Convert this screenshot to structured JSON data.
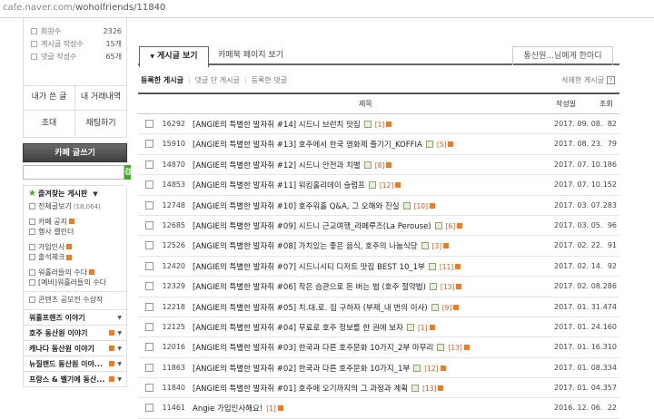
{
  "browser": {
    "url_prefix": "cafe.naver.com/",
    "url_path": "woholfriends/11840"
  },
  "sidebar": {
    "stats": [
      {
        "label": "회원수",
        "value": "2326"
      },
      {
        "label": "게시글 작성수",
        "value": "15개"
      },
      {
        "label": "댓글 작성수",
        "value": "65개"
      }
    ],
    "my_posts": "내가 쓴 글",
    "my_trades": "내 거래내역",
    "invite": "초대",
    "chat": "채팅하기",
    "write_button": "카페 글쓰기",
    "search_placeholder": "",
    "search_button": "검색",
    "favorites_title": "즐겨찾는 게시판",
    "all_posts": "전체글보기",
    "all_posts_count": "(18,064)",
    "menu_items": [
      "카페 공지",
      "행사 캘린더",
      "가입인사",
      "출석체크",
      "워홀러들의 수다",
      "[예비]워홀러들의 수다",
      "콘텐츠 공모전 수상작"
    ],
    "categories": [
      "워홀프렌즈 이야기",
      "호주 동산원 이야기",
      "캐나다 동산원 이야기",
      "뉴질랜드 동산원 이야...",
      "프랑스 & 벨기에 동산..."
    ]
  },
  "main": {
    "tabs": {
      "active": "게시글 보기",
      "second": "카페북 페이지 보기",
      "right": "통신원...님에게 한마디"
    },
    "filters": {
      "posts": "등록한 게시글",
      "commented": "댓글 단 게시글",
      "comments": "등록한 댓글",
      "deleted": "삭제한 게시글"
    },
    "columns": {
      "title": "제목",
      "author": "작성일",
      "views": "조회"
    },
    "rows": [
      {
        "num": "16292",
        "title": "[ANGIE의 특별한 발자취 #14] 시드니 브런치 맛집",
        "comments": "[1]",
        "date": "2017. 09. 08.",
        "views": "82"
      },
      {
        "num": "15910",
        "title": "[ANGIE의 특별한 발자취 #13] 호주에서 한국 영화제 즐기기_KOFFIA",
        "comments": "[5]",
        "date": "2017. 08. 23.",
        "views": "79"
      },
      {
        "num": "14870",
        "title": "[ANGIE의 특별한 발자취 #12] 시드니 안전과 치별",
        "comments": "[8]",
        "date": "2017. 07. 10.",
        "views": "186"
      },
      {
        "num": "14853",
        "title": "[ANGIE의 특별한 발자취 #11] 워킹홀리데이 슬럼프",
        "comments": "[12]",
        "date": "2017. 07. 10.",
        "views": "152"
      },
      {
        "num": "12748",
        "title": "[ANGIE의 특별한 발자취 #10] 호주워홀 Q&A, 그 오해와 진실",
        "comments": "[10]",
        "date": "2017. 03. 07.",
        "views": "283"
      },
      {
        "num": "12685",
        "title": "[ANGIE의 특별한 발자취 #09] 시드니 근교여행_라페루즈(La Perouse)",
        "comments": "[6]",
        "date": "2017. 03. 05.",
        "views": "96"
      },
      {
        "num": "12526",
        "title": "[ANGIE의 특별한 발자취 #08] 가치있는 좋은 음식, 호주의 나눔식당",
        "comments": "[3]",
        "date": "2017. 02. 22.",
        "views": "91"
      },
      {
        "num": "12420",
        "title": "[ANGIE의 특별한 발자취 #07] 시드니시티 디저트 맛집 BEST 10_1부",
        "comments": "[11]",
        "date": "2017. 02. 14.",
        "views": "92"
      },
      {
        "num": "12329",
        "title": "[ANGIE의 특별한 발자취 #06] 작은 습관으로 돈 버는 법 (호주 절약법)",
        "comments": "[13]",
        "date": "2017. 02. 08.",
        "views": "286"
      },
      {
        "num": "12218",
        "title": "[ANGIE의 특별한 발자취 #05] 치.대.로. 집 구하자 (부제_내 번의 이사)",
        "comments": "[9]",
        "date": "2017. 01. 31.",
        "views": "474"
      },
      {
        "num": "12125",
        "title": "[ANGIE의 특별한 발자취 #04] 무료로 호주 정보를 한 권에 보자",
        "comments": "[1]",
        "date": "2017. 01. 24.",
        "views": "160"
      },
      {
        "num": "12016",
        "title": "[ANGIE의 특별한 발자취 #03] 한국과 다른 호주문화 10가지_2부 마무리",
        "comments": "[13]",
        "date": "2017. 01. 16.",
        "views": "310"
      },
      {
        "num": "11863",
        "title": "[ANGIE의 특별한 발자취 #02] 한국과 다른 호주문화 10가지_1부",
        "comments": "[12]",
        "date": "2017. 01. 08.",
        "views": "334"
      },
      {
        "num": "11840",
        "title": "[ANGIE의 특별한 발자취 #01] 호주에 오기까지의 그 과정과 계획",
        "comments": "[13]",
        "date": "2017. 01. 04.",
        "views": "357"
      },
      {
        "num": "11461",
        "title": "Angie 가입인사해요!",
        "comments": "[1]",
        "date": "2016. 12. 06.",
        "views": "22"
      }
    ]
  },
  "colors": {
    "green": "#3cae1e",
    "orange": "#f47a20",
    "comment_red": "#e05a1e"
  }
}
